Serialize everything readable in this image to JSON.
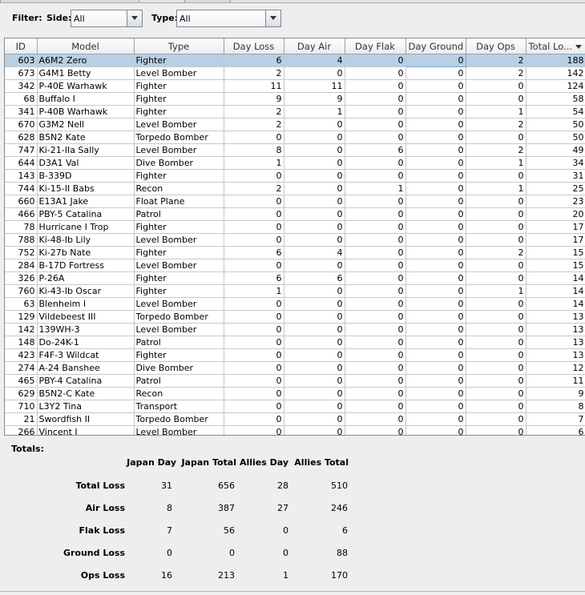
{
  "filter": {
    "label": "Filter:",
    "side_label": "Side:",
    "side_value": "All",
    "type_label": "Type:",
    "type_value": "All"
  },
  "table": {
    "columns": [
      "ID",
      "Model",
      "Type",
      "Day Loss",
      "Day Air",
      "Day Flak",
      "Day Ground",
      "Day Ops",
      "Total Lo..."
    ],
    "rows": [
      [
        "603",
        "A6M2 Zero",
        "Fighter",
        "6",
        "4",
        "0",
        "0",
        "2",
        "188"
      ],
      [
        "673",
        "G4M1 Betty",
        "Level Bomber",
        "2",
        "0",
        "0",
        "0",
        "2",
        "142"
      ],
      [
        "342",
        "P-40E Warhawk",
        "Fighter",
        "11",
        "11",
        "0",
        "0",
        "0",
        "124"
      ],
      [
        "68",
        "Buffalo I",
        "Fighter",
        "9",
        "9",
        "0",
        "0",
        "0",
        "58"
      ],
      [
        "341",
        "P-40B Warhawk",
        "Fighter",
        "2",
        "1",
        "0",
        "0",
        "1",
        "54"
      ],
      [
        "670",
        "G3M2 Nell",
        "Level Bomber",
        "2",
        "0",
        "0",
        "0",
        "2",
        "50"
      ],
      [
        "628",
        "B5N2 Kate",
        "Torpedo Bomber",
        "0",
        "0",
        "0",
        "0",
        "0",
        "50"
      ],
      [
        "747",
        "Ki-21-IIa Sally",
        "Level Bomber",
        "8",
        "0",
        "6",
        "0",
        "2",
        "49"
      ],
      [
        "644",
        "D3A1 Val",
        "Dive Bomber",
        "1",
        "0",
        "0",
        "0",
        "1",
        "34"
      ],
      [
        "143",
        "B-339D",
        "Fighter",
        "0",
        "0",
        "0",
        "0",
        "0",
        "31"
      ],
      [
        "744",
        "Ki-15-II Babs",
        "Recon",
        "2",
        "0",
        "1",
        "0",
        "1",
        "25"
      ],
      [
        "660",
        "E13A1 Jake",
        "Float Plane",
        "0",
        "0",
        "0",
        "0",
        "0",
        "23"
      ],
      [
        "466",
        "PBY-5 Catalina",
        "Patrol",
        "0",
        "0",
        "0",
        "0",
        "0",
        "20"
      ],
      [
        "78",
        "Hurricane I Trop",
        "Fighter",
        "0",
        "0",
        "0",
        "0",
        "0",
        "17"
      ],
      [
        "788",
        "Ki-48-Ib Lily",
        "Level Bomber",
        "0",
        "0",
        "0",
        "0",
        "0",
        "17"
      ],
      [
        "752",
        "Ki-27b Nate",
        "Fighter",
        "6",
        "4",
        "0",
        "0",
        "2",
        "15"
      ],
      [
        "284",
        "B-17D Fortress",
        "Level Bomber",
        "0",
        "0",
        "0",
        "0",
        "0",
        "15"
      ],
      [
        "326",
        "P-26A",
        "Fighter",
        "6",
        "6",
        "0",
        "0",
        "0",
        "14"
      ],
      [
        "760",
        "Ki-43-Ib Oscar",
        "Fighter",
        "1",
        "0",
        "0",
        "0",
        "1",
        "14"
      ],
      [
        "63",
        "Blenheim I",
        "Level Bomber",
        "0",
        "0",
        "0",
        "0",
        "0",
        "14"
      ],
      [
        "129",
        "Vildebeest III",
        "Torpedo Bomber",
        "0",
        "0",
        "0",
        "0",
        "0",
        "13"
      ],
      [
        "142",
        "139WH-3",
        "Level Bomber",
        "0",
        "0",
        "0",
        "0",
        "0",
        "13"
      ],
      [
        "148",
        "Do-24K-1",
        "Patrol",
        "0",
        "0",
        "0",
        "0",
        "0",
        "13"
      ],
      [
        "423",
        "F4F-3 Wildcat",
        "Fighter",
        "0",
        "0",
        "0",
        "0",
        "0",
        "13"
      ],
      [
        "274",
        "A-24 Banshee",
        "Dive Bomber",
        "0",
        "0",
        "0",
        "0",
        "0",
        "12"
      ],
      [
        "465",
        "PBY-4 Catalina",
        "Patrol",
        "0",
        "0",
        "0",
        "0",
        "0",
        "11"
      ],
      [
        "629",
        "B5N2-C Kate",
        "Recon",
        "0",
        "0",
        "0",
        "0",
        "0",
        "9"
      ],
      [
        "710",
        "L3Y2 Tina",
        "Transport",
        "0",
        "0",
        "0",
        "0",
        "0",
        "8"
      ],
      [
        "21",
        "Swordfish II",
        "Torpedo Bomber",
        "0",
        "0",
        "0",
        "0",
        "0",
        "7"
      ],
      [
        "266",
        "Vincent I",
        "Level Bomber",
        "0",
        "0",
        "0",
        "0",
        "0",
        "6"
      ]
    ]
  },
  "totals": {
    "title": "Totals:",
    "columns": [
      "Japan Day",
      "Japan Total",
      "Allies Day",
      "Allies Total"
    ],
    "rows": [
      {
        "label": "Total Loss",
        "values": [
          "31",
          "656",
          "28",
          "510"
        ]
      },
      {
        "label": "Air Loss",
        "values": [
          "8",
          "387",
          "27",
          "246"
        ]
      },
      {
        "label": "Flak Loss",
        "values": [
          "7",
          "56",
          "0",
          "6"
        ]
      },
      {
        "label": "Ground Loss",
        "values": [
          "0",
          "0",
          "0",
          "88"
        ]
      },
      {
        "label": "Ops Loss",
        "values": [
          "16",
          "213",
          "1",
          "170"
        ]
      }
    ]
  }
}
